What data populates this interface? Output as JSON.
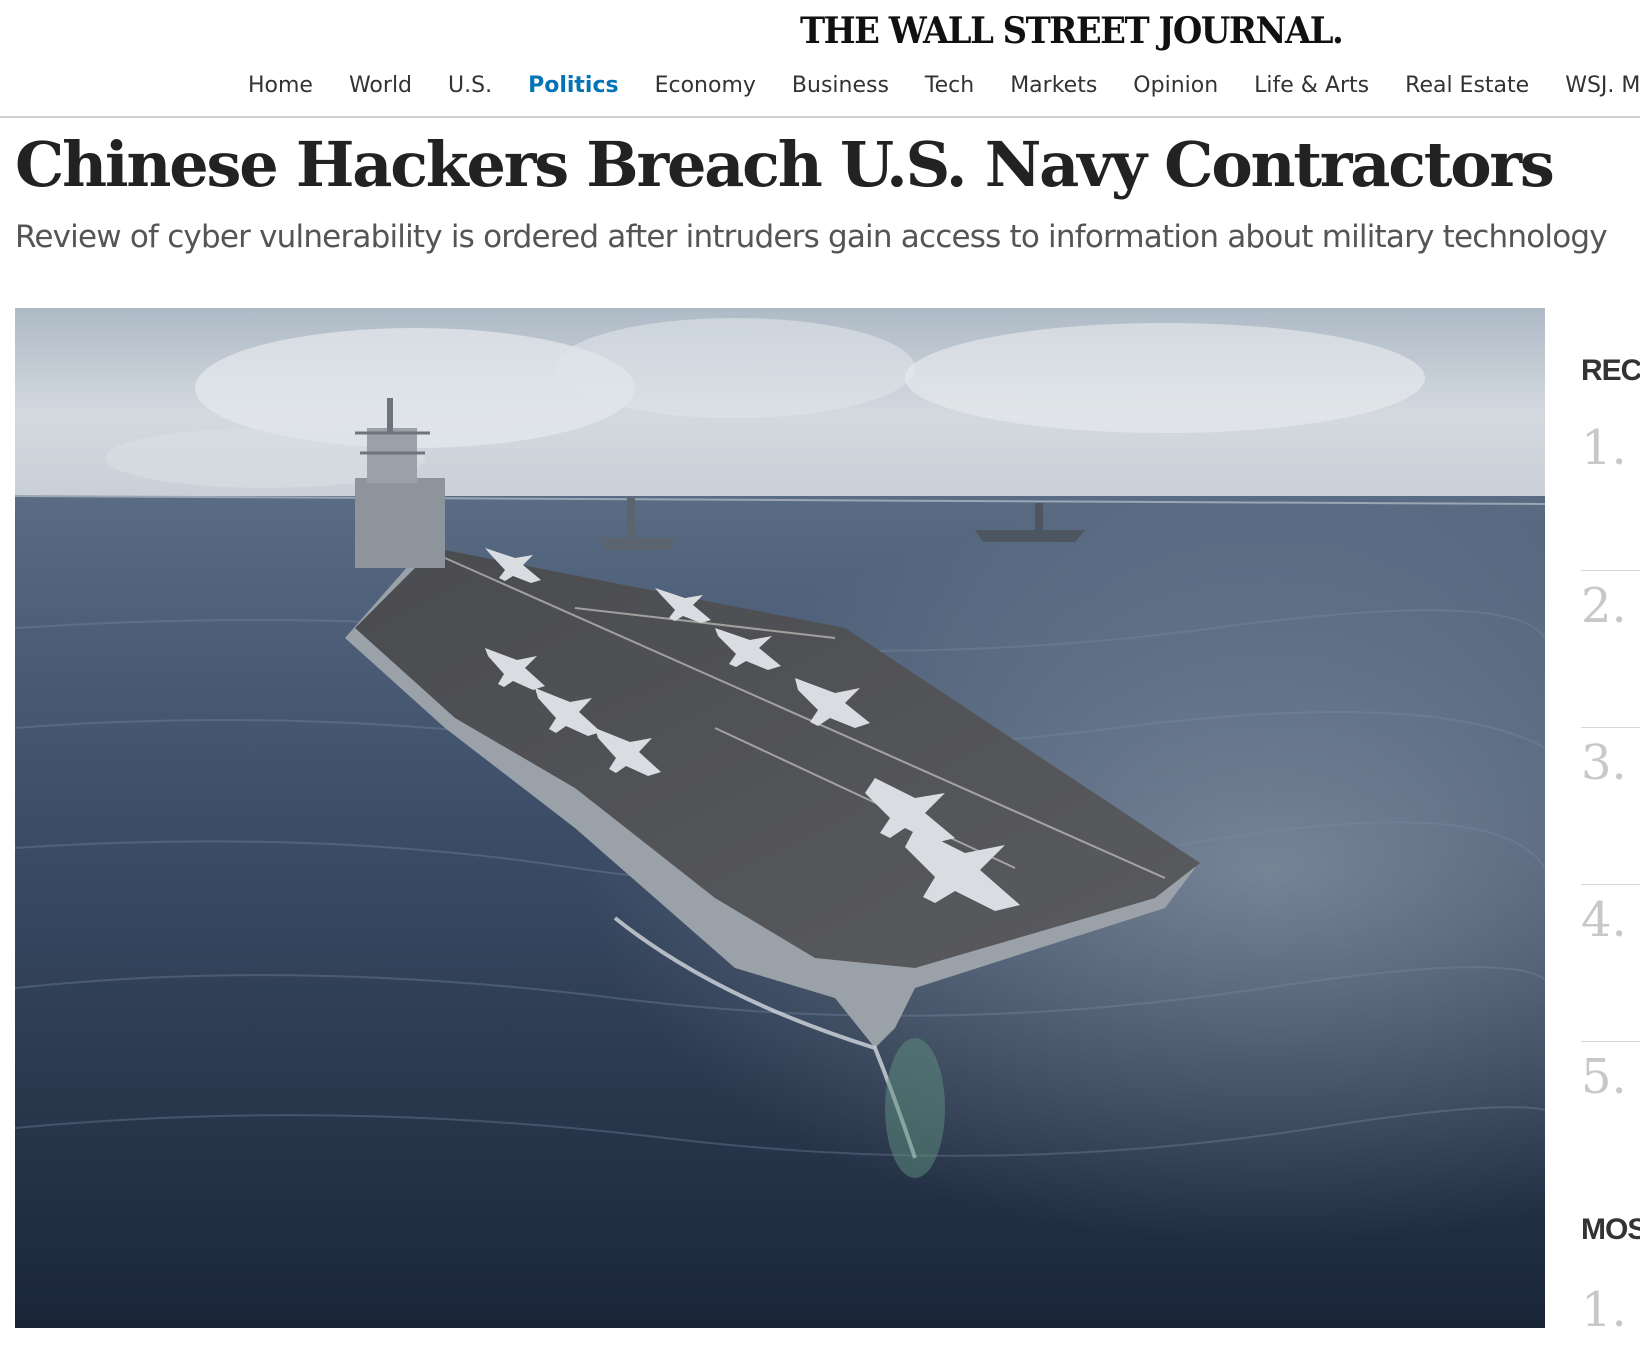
{
  "header": {
    "masthead": "THE WALL STREET JOURNAL.",
    "nav": [
      "Home",
      "World",
      "U.S.",
      "Politics",
      "Economy",
      "Business",
      "Tech",
      "Markets",
      "Opinion",
      "Life & Arts",
      "Real Estate",
      "WSJ. M"
    ],
    "active_nav": "Politics"
  },
  "article": {
    "headline": "Chinese Hackers Breach U.S. Navy Contractors",
    "dek": "Review of cyber vulnerability is ordered after intruders gain access to information about military technology"
  },
  "sidebar": {
    "recommended_title": "RECO",
    "recommended_numbers": [
      "1.",
      "2.",
      "3.",
      "4.",
      "5."
    ],
    "most_title": "MOS",
    "most_numbers": [
      "1."
    ]
  },
  "colors": {
    "accent": "#0274b6",
    "text": "#333333",
    "muted": "#c8c8c8"
  }
}
